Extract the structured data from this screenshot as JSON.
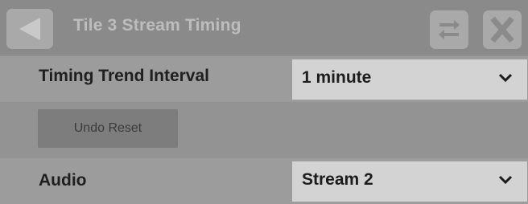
{
  "header": {
    "title": "Tile 3 Stream Timing"
  },
  "rows": {
    "timing_trend": {
      "label": "Timing Trend Interval",
      "value": "1 minute"
    },
    "undo": {
      "label": "Undo Reset"
    },
    "audio": {
      "label": "Audio",
      "value": "Stream 2"
    }
  },
  "icons": {
    "back": "back-arrow-icon",
    "swap": "swap-arrows-icon",
    "close": "close-x-icon",
    "dropdown": "chevron-down-icon"
  }
}
